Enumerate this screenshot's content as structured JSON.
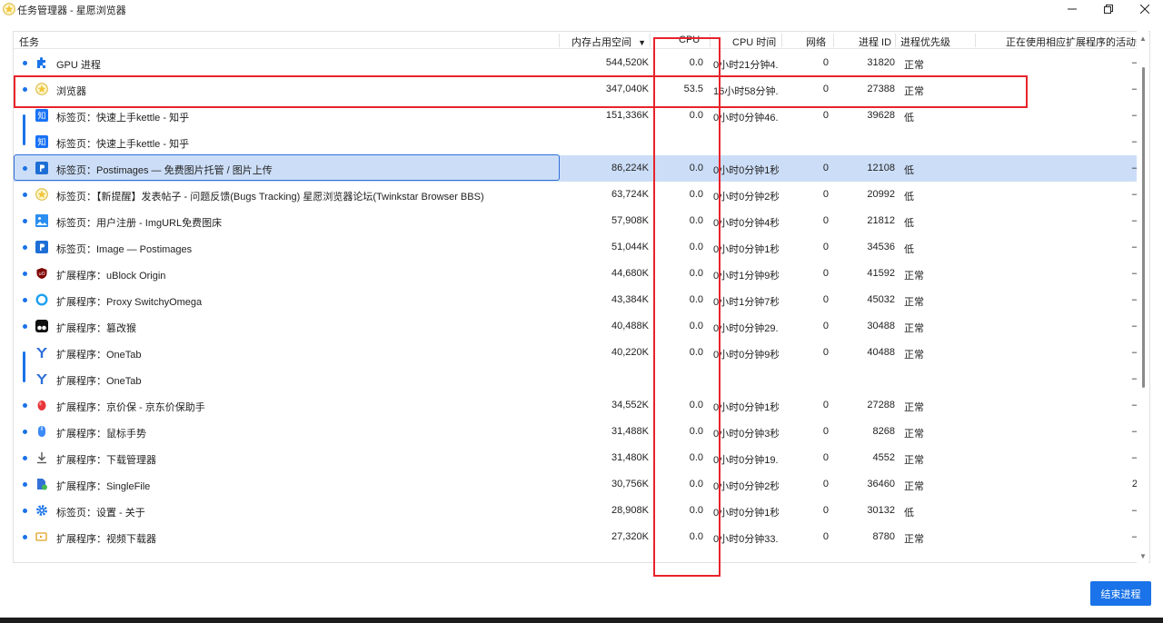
{
  "window": {
    "title": "任务管理器 - 星愿浏览器",
    "minimize": "—",
    "maximize": "❐",
    "close": "✕"
  },
  "columns": {
    "task": "任务",
    "memory": "内存占用空间",
    "sort_indicator": "▼",
    "cpu": "CPU",
    "cpu_time": "CPU 时间",
    "network": "网络",
    "pid": "进程 ID",
    "priority": "进程优先级",
    "extension_activity": "正在使用相应扩展程序的活动数"
  },
  "rows": [
    {
      "icon": "puzzle-icon",
      "task": "GPU 进程",
      "mem": "544,520K",
      "cpu": "0.0",
      "time": "0小时21分钟4...",
      "net": "0",
      "pid": "31820",
      "prio": "正常",
      "ext": "–",
      "bullet": true
    },
    {
      "icon": "twinkstar-icon",
      "task": "浏览器",
      "mem": "347,040K",
      "cpu": "53.5",
      "time": "16小时58分钟...",
      "net": "0",
      "pid": "27388",
      "prio": "正常",
      "ext": "–",
      "bullet": true
    },
    {
      "icon": "zhihu-icon",
      "task": "标签页：快速上手kettle - 知乎",
      "mem": "151,336K",
      "cpu": "0.0",
      "time": "0小时0分钟46...",
      "net": "0",
      "pid": "39628",
      "prio": "低",
      "ext": "–",
      "bullet": false
    },
    {
      "icon": "zhihu-icon",
      "task": "标签页：快速上手kettle - 知乎",
      "mem": "",
      "cpu": "",
      "time": "",
      "net": "",
      "pid": "",
      "prio": "",
      "ext": "–",
      "bullet": false
    },
    {
      "icon": "postimages-icon",
      "task": "标签页：Postimages — 免费图片托管 / 图片上传",
      "mem": "86,224K",
      "cpu": "0.0",
      "time": "0小时0分钟1秒",
      "net": "0",
      "pid": "12108",
      "prio": "低",
      "ext": "–",
      "bullet": true,
      "selected": true
    },
    {
      "icon": "twinkstar-icon",
      "task": "标签页：【新提醒】发表帖子 - 问题反馈(Bugs Tracking) 星愿浏览器论坛(Twinkstar Browser BBS)",
      "mem": "63,724K",
      "cpu": "0.0",
      "time": "0小时0分钟2秒",
      "net": "0",
      "pid": "20992",
      "prio": "低",
      "ext": "–",
      "bullet": true
    },
    {
      "icon": "image-icon",
      "task": "标签页：用户注册 - ImgURL免费图床",
      "mem": "57,908K",
      "cpu": "0.0",
      "time": "0小时0分钟4秒",
      "net": "0",
      "pid": "21812",
      "prio": "低",
      "ext": "–",
      "bullet": true
    },
    {
      "icon": "postimages-icon",
      "task": "标签页：Image — Postimages",
      "mem": "51,044K",
      "cpu": "0.0",
      "time": "0小时0分钟1秒",
      "net": "0",
      "pid": "34536",
      "prio": "低",
      "ext": "–",
      "bullet": true
    },
    {
      "icon": "ublock-icon",
      "task": "扩展程序：uBlock Origin",
      "mem": "44,680K",
      "cpu": "0.0",
      "time": "0小时1分钟9秒",
      "net": "0",
      "pid": "41592",
      "prio": "正常",
      "ext": "–",
      "bullet": true
    },
    {
      "icon": "proxy-icon",
      "task": "扩展程序：Proxy SwitchyOmega",
      "mem": "43,384K",
      "cpu": "0.0",
      "time": "0小时1分钟7秒",
      "net": "0",
      "pid": "45032",
      "prio": "正常",
      "ext": "–",
      "bullet": true
    },
    {
      "icon": "tampermonkey-icon",
      "task": "扩展程序：篡改猴",
      "mem": "40,488K",
      "cpu": "0.0",
      "time": "0小时0分钟29...",
      "net": "0",
      "pid": "30488",
      "prio": "正常",
      "ext": "–",
      "bullet": true
    },
    {
      "icon": "onetab-icon",
      "task": "扩展程序：OneTab",
      "mem": "40,220K",
      "cpu": "0.0",
      "time": "0小时0分钟9秒",
      "net": "0",
      "pid": "40488",
      "prio": "正常",
      "ext": "–",
      "bullet": false
    },
    {
      "icon": "onetab-icon",
      "task": "扩展程序：OneTab",
      "mem": "",
      "cpu": "",
      "time": "",
      "net": "",
      "pid": "",
      "prio": "",
      "ext": "–",
      "bullet": false
    },
    {
      "icon": "jd-price-icon",
      "task": "扩展程序：京价保 - 京东价保助手",
      "mem": "34,552K",
      "cpu": "0.0",
      "time": "0小时0分钟1秒",
      "net": "0",
      "pid": "27288",
      "prio": "正常",
      "ext": "–",
      "bullet": true
    },
    {
      "icon": "mouse-gesture-icon",
      "task": "扩展程序：鼠标手势",
      "mem": "31,488K",
      "cpu": "0.0",
      "time": "0小时0分钟3秒",
      "net": "0",
      "pid": "8268",
      "prio": "正常",
      "ext": "–",
      "bullet": true
    },
    {
      "icon": "download-icon",
      "task": "扩展程序：下载管理器",
      "mem": "31,480K",
      "cpu": "0.0",
      "time": "0小时0分钟19...",
      "net": "0",
      "pid": "4552",
      "prio": "正常",
      "ext": "–",
      "bullet": true
    },
    {
      "icon": "singlefile-icon",
      "task": "扩展程序：SingleFile",
      "mem": "30,756K",
      "cpu": "0.0",
      "time": "0小时0分钟2秒",
      "net": "0",
      "pid": "36460",
      "prio": "正常",
      "ext": "2",
      "bullet": true
    },
    {
      "icon": "gear-icon",
      "task": "标签页：设置 - 关于",
      "mem": "28,908K",
      "cpu": "0.0",
      "time": "0小时0分钟1秒",
      "net": "0",
      "pid": "30132",
      "prio": "低",
      "ext": "–",
      "bullet": true
    },
    {
      "icon": "video-download-icon",
      "task": "扩展程序：视频下载器",
      "mem": "27,320K",
      "cpu": "0.0",
      "time": "0小时0分钟33...",
      "net": "0",
      "pid": "8780",
      "prio": "正常",
      "ext": "–",
      "bullet": true
    }
  ],
  "footer": {
    "end_process_label": "结束进程"
  },
  "colors": {
    "accent": "#1a73e8",
    "selected_row": "#ccdef7",
    "annotation": "#e8232a"
  }
}
